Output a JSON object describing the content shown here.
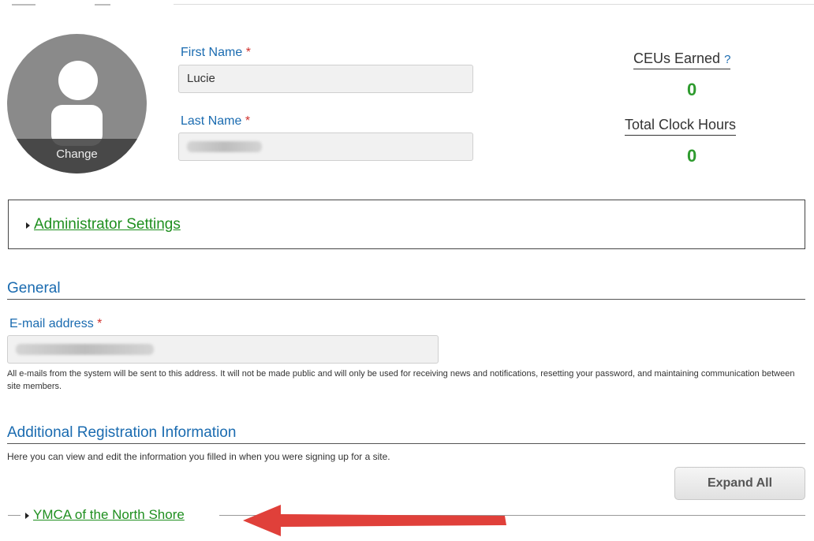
{
  "profile": {
    "avatar_change_label": "Change",
    "first_name_label": "First Name",
    "first_name_value": "Lucie",
    "last_name_label": "Last Name",
    "required_marker": "*"
  },
  "stats": {
    "ceus_label": "CEUs Earned",
    "ceus_help": "?",
    "ceus_value": "0",
    "clock_hours_label": "Total Clock Hours",
    "clock_hours_value": "0"
  },
  "admin": {
    "label": "Administrator Settings"
  },
  "general": {
    "title": "General",
    "email_label": "E-mail address",
    "email_help": "All e-mails from the system will be sent to this address. It will not be made public and will only be used for receiving news and notifications, resetting your password, and maintaining communication between site members."
  },
  "additional": {
    "title": "Additional Registration Information",
    "description": "Here you can view and edit the information you filled in when you were signing up for a site.",
    "expand_all_label": "Expand All",
    "group_label": "YMCA of the North Shore"
  },
  "colors": {
    "link": "#1f8f1f",
    "label": "#1a6bb0",
    "required": "#d0312d",
    "annotation_arrow": "#e0403a"
  }
}
